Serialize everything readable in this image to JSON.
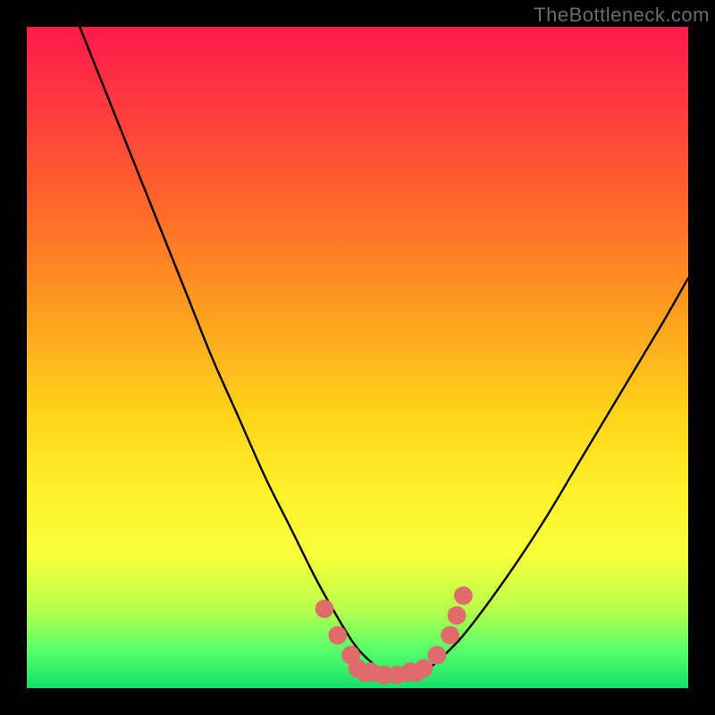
{
  "watermark": "TheBottleneck.com",
  "chart_data": {
    "type": "line",
    "title": "",
    "xlabel": "",
    "ylabel": "",
    "xlim": [
      0,
      100
    ],
    "ylim": [
      0,
      100
    ],
    "grid": false,
    "legend": false,
    "series": [
      {
        "name": "curve",
        "x": [
          8,
          12,
          16,
          20,
          24,
          28,
          32,
          36,
          40,
          44,
          48,
          50,
          52,
          54,
          56,
          58,
          60,
          62,
          66,
          72,
          78,
          84,
          90,
          96,
          100
        ],
        "values": [
          100,
          90,
          80,
          70,
          60,
          50,
          41,
          32,
          24,
          16,
          9,
          6,
          4,
          2.5,
          2,
          2,
          2.5,
          4,
          8,
          16,
          25,
          35,
          45,
          55,
          62
        ]
      }
    ],
    "markers": {
      "name": "highlight-dots",
      "color": "#e06b6b",
      "radius_pct": 1.4,
      "points": [
        {
          "x": 45,
          "y": 12
        },
        {
          "x": 47,
          "y": 8
        },
        {
          "x": 49,
          "y": 5
        },
        {
          "x": 50,
          "y": 3
        },
        {
          "x": 52,
          "y": 2.5
        },
        {
          "x": 54,
          "y": 2
        },
        {
          "x": 56,
          "y": 2
        },
        {
          "x": 58,
          "y": 2.5
        },
        {
          "x": 60,
          "y": 3
        },
        {
          "x": 62,
          "y": 5
        },
        {
          "x": 64,
          "y": 8
        },
        {
          "x": 65,
          "y": 11
        },
        {
          "x": 66,
          "y": 14
        }
      ]
    },
    "flat_bottom_bar": {
      "color": "#e06b6b",
      "x_from": 50,
      "x_to": 60,
      "y": 2,
      "thickness_pct": 2
    }
  }
}
